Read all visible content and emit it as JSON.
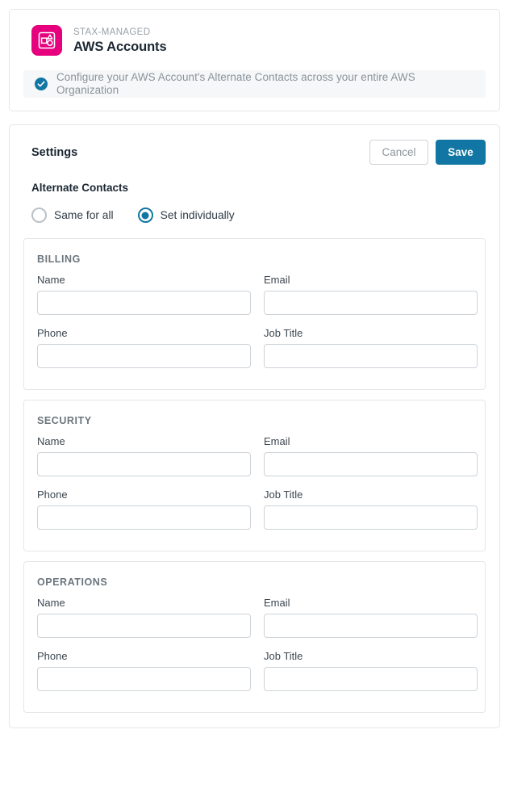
{
  "header": {
    "icon_name": "stax-shapes-icon",
    "brand_color": "#e6007e",
    "eyebrow": "STAX-MANAGED",
    "title": "AWS Accounts",
    "notice": {
      "icon_name": "check-circle-icon",
      "icon_color": "#1176a3",
      "text": "Configure your AWS Account's Alternate Contacts across your entire AWS Organization"
    }
  },
  "settings": {
    "title": "Settings",
    "cancel_label": "Cancel",
    "save_label": "Save",
    "save_color": "#1176a3",
    "section_title": "Alternate Contacts",
    "radio_options": [
      {
        "label": "Same for all",
        "checked": false
      },
      {
        "label": "Set individually",
        "checked": true
      }
    ],
    "groups": [
      {
        "title": "BILLING",
        "fields": [
          {
            "label": "Name",
            "value": "",
            "placeholder": ""
          },
          {
            "label": "Email",
            "value": "",
            "placeholder": ""
          },
          {
            "label": "Phone",
            "value": "",
            "placeholder": ""
          },
          {
            "label": "Job Title",
            "value": "",
            "placeholder": ""
          }
        ]
      },
      {
        "title": "SECURITY",
        "fields": [
          {
            "label": "Name",
            "value": "",
            "placeholder": ""
          },
          {
            "label": "Email",
            "value": "",
            "placeholder": ""
          },
          {
            "label": "Phone",
            "value": "",
            "placeholder": ""
          },
          {
            "label": "Job Title",
            "value": "",
            "placeholder": ""
          }
        ]
      },
      {
        "title": "OPERATIONS",
        "fields": [
          {
            "label": "Name",
            "value": "",
            "placeholder": ""
          },
          {
            "label": "Email",
            "value": "",
            "placeholder": ""
          },
          {
            "label": "Phone",
            "value": "",
            "placeholder": ""
          },
          {
            "label": "Job Title",
            "value": "",
            "placeholder": ""
          }
        ]
      }
    ]
  }
}
